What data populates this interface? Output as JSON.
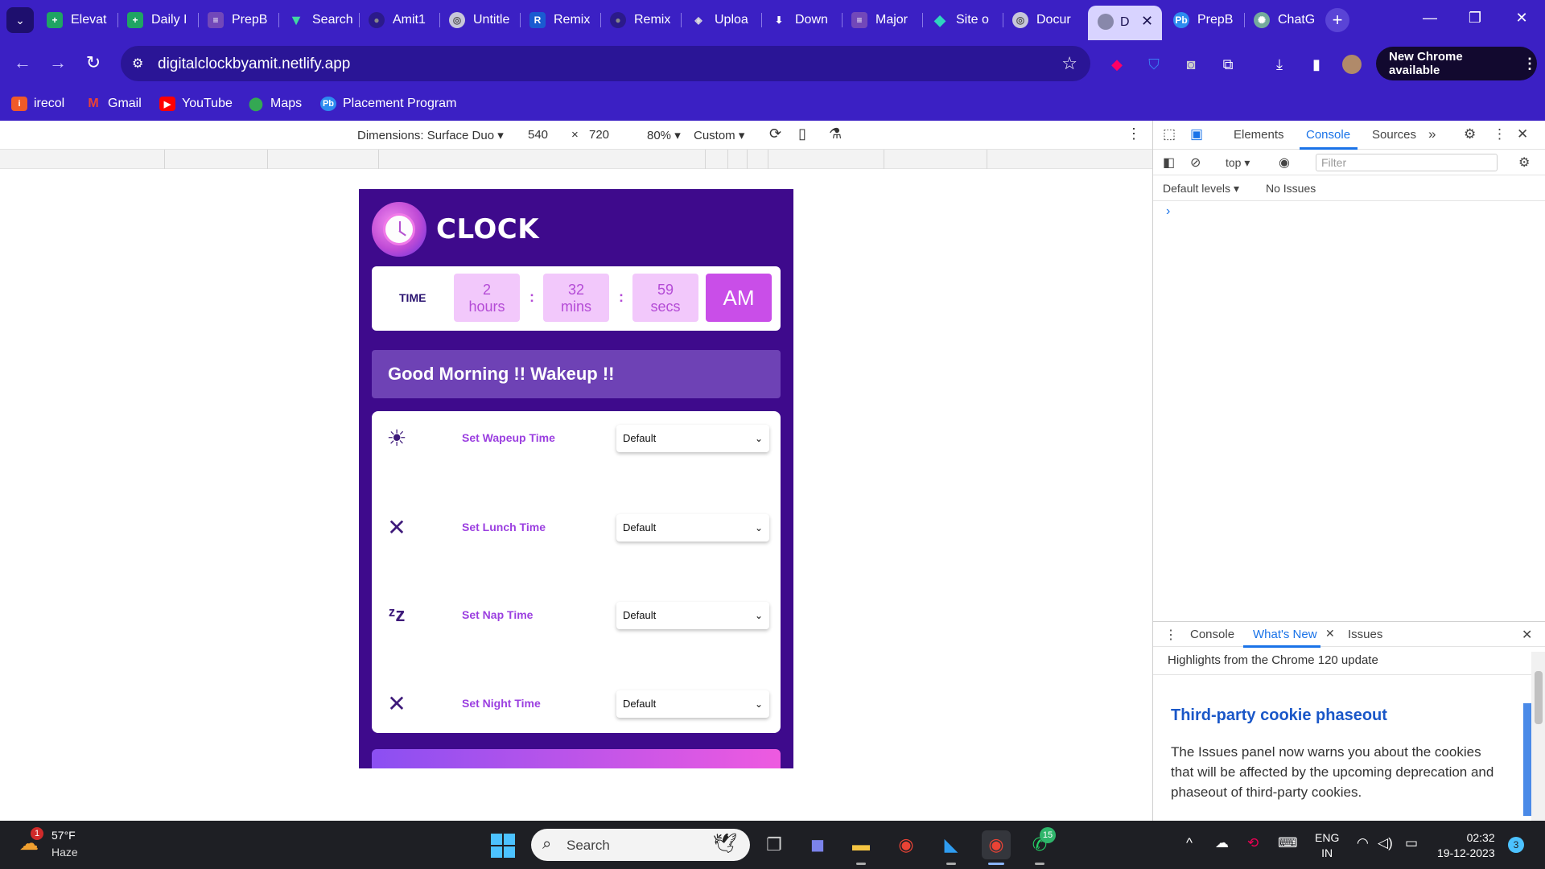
{
  "browser": {
    "tabs": [
      {
        "label": "Elevat",
        "icon": "sheets-plus-icon"
      },
      {
        "label": "Daily I",
        "icon": "sheets-plus-icon"
      },
      {
        "label": "PrepB",
        "icon": "forms-icon"
      },
      {
        "label": "Search",
        "icon": "vue-icon"
      },
      {
        "label": "Amit1",
        "icon": "github-icon"
      },
      {
        "label": "Untitle",
        "icon": "globe-icon"
      },
      {
        "label": "Remix",
        "icon": "remix-icon"
      },
      {
        "label": "Remix",
        "icon": "github-icon"
      },
      {
        "label": "Uploa",
        "icon": "layers-icon"
      },
      {
        "label": "Down",
        "icon": "download-icon"
      },
      {
        "label": "Major",
        "icon": "forms-icon"
      },
      {
        "label": "Site o",
        "icon": "netlify-icon"
      },
      {
        "label": "Docur",
        "icon": "globe-icon"
      }
    ],
    "active_tab": {
      "label": "D"
    },
    "tabs_after": [
      {
        "label": "PrepB",
        "icon": "prepbytes-icon"
      },
      {
        "label": "ChatG",
        "icon": "chatgpt-icon"
      }
    ],
    "url": "digitalclockbyamit.netlify.app",
    "new_chrome_label": "New Chrome available",
    "bookmarks": [
      {
        "label": "irecol",
        "icon": "irecol-icon"
      },
      {
        "label": "Gmail",
        "icon": "gmail-icon"
      },
      {
        "label": "YouTube",
        "icon": "youtube-icon"
      },
      {
        "label": "Maps",
        "icon": "maps-icon"
      },
      {
        "label": "Placement Program",
        "icon": "prepbytes-icon"
      }
    ]
  },
  "device_toolbar": {
    "dimensions_label": "Dimensions: Surface Duo",
    "width": "540",
    "times": "×",
    "height": "720",
    "zoom": "80%",
    "throttle": "Custom"
  },
  "app": {
    "title": "CLOCK",
    "time_label": "TIME",
    "hours_value": "2",
    "hours_unit": "hours",
    "mins_value": "32",
    "mins_unit": "mins",
    "secs_value": "59",
    "secs_unit": "secs",
    "separator": ":",
    "ampm": "AM",
    "greeting": "Good Morning !! Wakeup !!",
    "settings": [
      {
        "label": "Set Wapeup Time",
        "value": "Default",
        "icon": "sun-icon"
      },
      {
        "label": "Set Lunch Time",
        "value": "Default",
        "icon": "fork-spoon-icon"
      },
      {
        "label": "Set Nap Time",
        "value": "Default",
        "icon": "zzz-icon"
      },
      {
        "label": "Set Night Time",
        "value": "Default",
        "icon": "fork-spoon-icon"
      }
    ]
  },
  "devtools": {
    "tabs": [
      "Elements",
      "Console",
      "Sources"
    ],
    "active_tab": "Console",
    "context": "top",
    "filter_placeholder": "Filter",
    "levels": "Default levels",
    "issues": "No Issues",
    "prompt": "›",
    "drawer_tabs": [
      "Console",
      "What's New",
      "Issues"
    ],
    "drawer_active": "What's New",
    "highlights": "Highlights from the Chrome 120 update",
    "whats_new_heading": "Third-party cookie phaseout",
    "whats_new_body": "The Issues panel now warns you about the cookies that will be affected by the upcoming deprecation and phaseout of third-party cookies."
  },
  "taskbar": {
    "weather_badge": "1",
    "temperature": "57°F",
    "condition": "Haze",
    "search_label": "Search",
    "whatsapp_badge": "15",
    "lang_top": "ENG",
    "lang_bottom": "IN",
    "time": "02:32",
    "date": "19-12-2023",
    "notifications": "3"
  }
}
